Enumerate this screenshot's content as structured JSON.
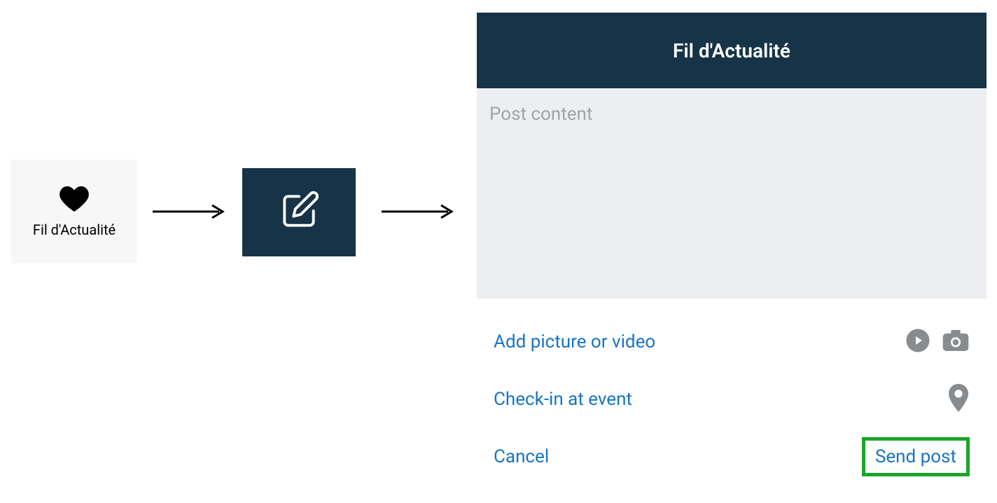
{
  "step1": {
    "label": "Fil d'Actualité"
  },
  "panel": {
    "title": "Fil d'Actualité",
    "placeholder": "Post content",
    "add_media_label": "Add picture or video",
    "checkin_label": "Check-in at event",
    "cancel_label": "Cancel",
    "send_label": "Send post"
  }
}
